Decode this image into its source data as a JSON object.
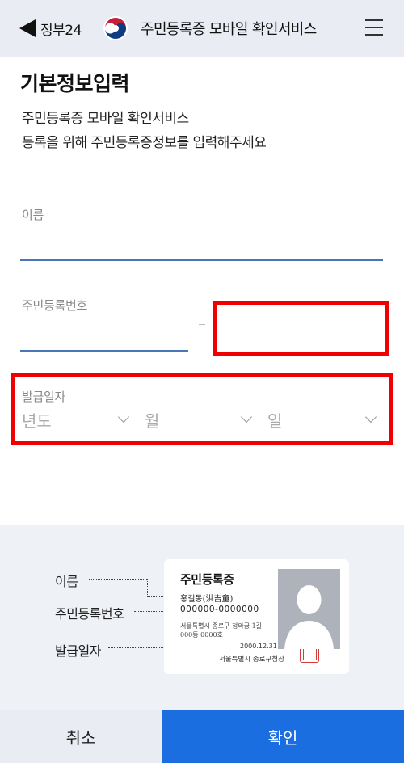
{
  "header": {
    "back_label": "정부24",
    "title": "주민등록증 모바일 확인서비스"
  },
  "page": {
    "title": "기본정보입력",
    "desc_line1": "주민등록증 모바일 확인서비스",
    "desc_line2": "등록을 위해 주민등록증정보를 입력해주세요"
  },
  "form": {
    "name_label": "이름",
    "name_value": "",
    "rrn_label": "주민등록번호",
    "rrn_front_value": "",
    "rrn_back_value": "",
    "issue_label": "발급일자",
    "year_placeholder": "년도",
    "month_placeholder": "월",
    "day_placeholder": "일"
  },
  "guide": {
    "label_name": "이름",
    "label_rrn": "주민등록번호",
    "label_issue": "발급일자",
    "card": {
      "title": "주민등록증",
      "name": "홍길동(洪吉童)",
      "rrn": "000000-0000000",
      "address_line1": "서울특별시 종로구 청와궁 1길",
      "address_line2": "000동 0000호",
      "issue_date": "2000.12.31",
      "issuer": "서울특별시 종로구청장"
    }
  },
  "buttons": {
    "cancel": "취소",
    "confirm": "확인"
  },
  "colors": {
    "header_bg": "#e9edf3",
    "accent": "#1a6ee0",
    "underline": "#4a76b4",
    "highlight": "#f00000"
  }
}
